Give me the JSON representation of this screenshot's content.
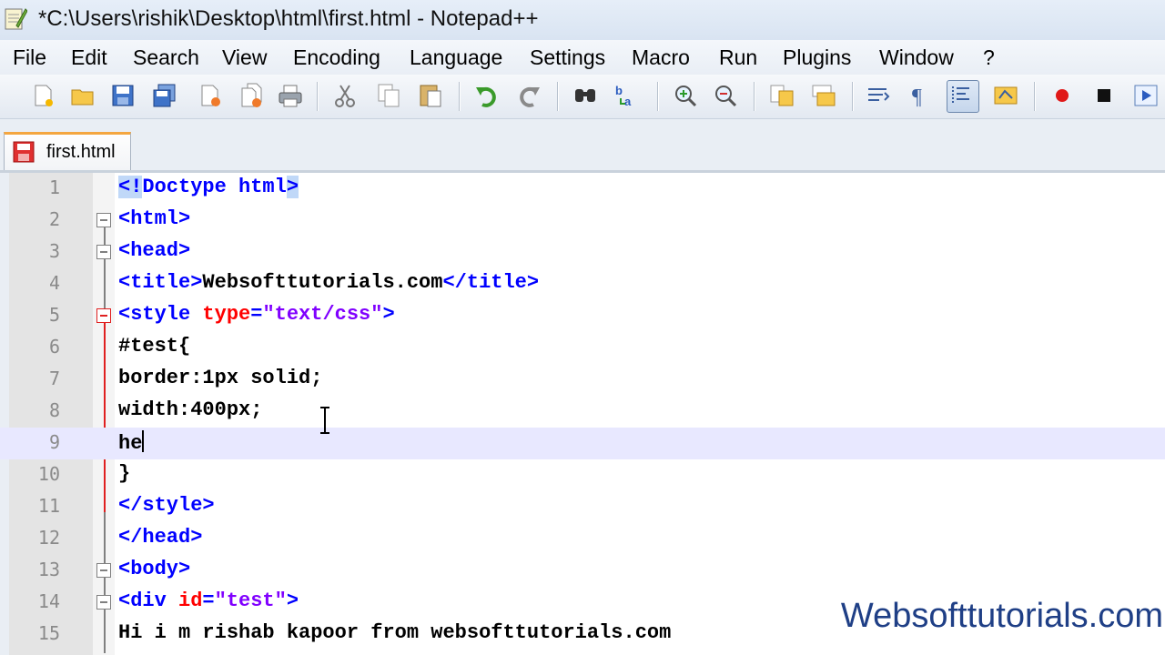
{
  "window": {
    "title": "*C:\\Users\\rishik\\Desktop\\html\\first.html - Notepad++"
  },
  "menu": [
    "File",
    "Edit",
    "Search",
    "View",
    "Encoding",
    "Language",
    "Settings",
    "Macro",
    "Run",
    "Plugins",
    "Window",
    "?"
  ],
  "toolbar": [
    "new-file-icon",
    "open-file-icon",
    "save-icon",
    "save-all-icon",
    "close-icon",
    "close-all-icon",
    "print-icon",
    "cut-icon",
    "copy-icon",
    "paste-icon",
    "undo-icon",
    "redo-icon",
    "find-icon",
    "replace-icon",
    "zoom-in-icon",
    "zoom-out-icon",
    "sync-vertical-icon",
    "sync-horizontal-icon",
    "word-wrap-icon",
    "show-all-chars-icon",
    "indent-guide-icon",
    "user-lang-icon",
    "record-macro-icon",
    "stop-record-icon",
    "play-macro-icon"
  ],
  "tab": {
    "label": "first.html"
  },
  "editor": {
    "lines": [
      {
        "n": "1",
        "text": "<!Doctype html>"
      },
      {
        "n": "2",
        "text": "<html>"
      },
      {
        "n": "3",
        "text": "<head>"
      },
      {
        "n": "4",
        "text": "<title>Websofttutorials.com</title>"
      },
      {
        "n": "5",
        "text": "<style type=\"text/css\">"
      },
      {
        "n": "6",
        "text": "#test{"
      },
      {
        "n": "7",
        "text": "border:1px solid;"
      },
      {
        "n": "8",
        "text": "width:400px;"
      },
      {
        "n": "9",
        "text": "he"
      },
      {
        "n": "10",
        "text": "}"
      },
      {
        "n": "11",
        "text": "</style>"
      },
      {
        "n": "12",
        "text": "</head>"
      },
      {
        "n": "13",
        "text": "<body>"
      },
      {
        "n": "14",
        "text": "<div id=\"test\">"
      },
      {
        "n": "15",
        "text": "Hi i m rishab kapoor from websofttutorials.com"
      }
    ]
  },
  "watermark": "Websofttutorials.com",
  "colors": {
    "tag": "#0000ff",
    "attr": "#ff0000",
    "string": "#8000ff",
    "selection": "#c0d8f8"
  }
}
